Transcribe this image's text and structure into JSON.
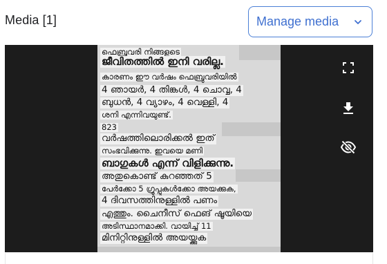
{
  "header": {
    "title": "Media [1]",
    "manage_button": "Manage media",
    "chevron_icon": "chevron-down-icon"
  },
  "media": {
    "text_lines": [
      "ഫെബ്രുവരി നിങ്ങളുടെ",
      "ജീവിതത്തിൽ ഇനി വരില്ല.",
      "കാരണം ഈ വർഷം ഫെബ്രുവരിയിൽ",
      "4 ഞായർ, 4 തിങ്കൾ, 4 ചൊവ്വ, 4",
      "ബുധൻ, 4 വ്യാഴം, 4 വെള്ളി, 4",
      "ശനി എന്നിവയുണ്ട്.",
      "823",
      "വർഷത്തിലൊരിക്കൽ ഇത്",
      "സംഭവിക്കുന്നു. ഇവയെ മണി",
      "ബാഗുകൾ എന്ന് വിളിക്കുന്നു.",
      "അതുകൊണ്ട് കുറഞ്ഞത് 5",
      "പേർക്കോ 5 ഗ്രൂപ്പുകൾക്കോ അയക്കുക,",
      "4 ദിവസത്തിനുള്ളിൽ പണം",
      "എത്തും. ചൈനീസ് ഫെങ് ഷൂയിയെ",
      "അടിസ്ഥാനമാക്കി. വായിച്ച് 11",
      "മിനിറ്റിനുള്ളിൽ അയയ്ക്കുക"
    ]
  },
  "toolbar": {
    "fullscreen_icon": "fullscreen-icon",
    "download_icon": "download-icon",
    "hide_icon": "visibility-off-icon"
  },
  "colors": {
    "accent": "#3f70d0",
    "viewer_bg": "#1c1c1c",
    "icon": "#ffffff"
  }
}
